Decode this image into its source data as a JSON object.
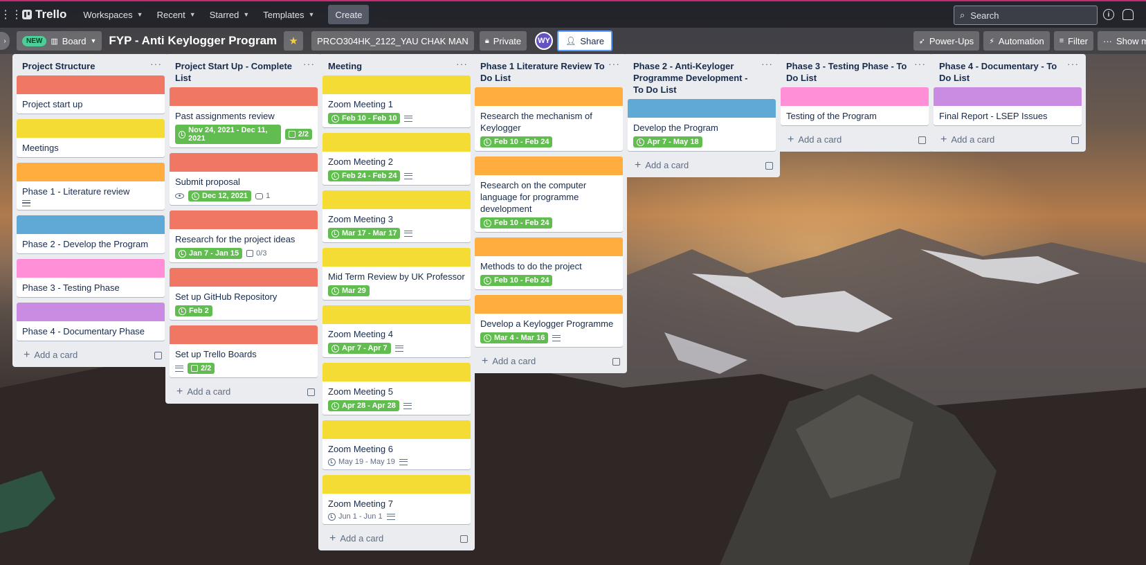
{
  "topbar": {
    "logo": "Trello",
    "nav": [
      "Workspaces",
      "Recent",
      "Starred",
      "Templates"
    ],
    "create_label": "Create",
    "search_label": "Search"
  },
  "board": {
    "new_badge": "NEW",
    "view_label": "Board",
    "title": "FYP - Anti Keylogger Program",
    "workspace": "PRCO304HK_2122_YAU CHAK MAN",
    "visibility": "Private",
    "avatar_initials": "WY",
    "share_label": "Share",
    "power_ups": "Power-Ups",
    "automation": "Automation",
    "filter": "Filter",
    "show_menu": "Show menu"
  },
  "add_card_label": "Add a card",
  "colors": {
    "red": "#f07763",
    "yellow": "#f5dc35",
    "orange": "#ffad3e",
    "blue": "#5fa9d6",
    "pink": "#ff8fd7",
    "purple": "#ca8ce2",
    "green": "#61bd4f"
  },
  "lists": [
    {
      "title": "Project Structure",
      "cards": [
        {
          "title": "Project start up",
          "color": "red"
        },
        {
          "title": "Meetings",
          "color": "yellow"
        },
        {
          "title": "Phase 1 - Literature review",
          "color": "orange",
          "desc": true
        },
        {
          "title": "Phase 2 - Develop the Program",
          "color": "blue"
        },
        {
          "title": "Phase 3 - Testing Phase",
          "color": "pink"
        },
        {
          "title": "Phase 4 - Documentary Phase",
          "color": "purple"
        }
      ]
    },
    {
      "title": "Project Start Up - Complete List",
      "cards": [
        {
          "title": "Past assignments review",
          "color": "red",
          "date": "Nov 24, 2021 - Dec 11, 2021",
          "check": "2/2",
          "check_done": true
        },
        {
          "title": "Submit proposal",
          "color": "red",
          "watch": true,
          "date": "Dec 12, 2021",
          "comments": "1"
        },
        {
          "title": "Research for the project ideas",
          "color": "red",
          "date": "Jan 7 - Jan 15",
          "check": "0/3",
          "check_done": false
        },
        {
          "title": "Set up GitHub Repository",
          "color": "red",
          "date": "Feb 2"
        },
        {
          "title": "Set up Trello Boards",
          "color": "red",
          "desc": true,
          "check": "2/2",
          "check_done": true
        }
      ]
    },
    {
      "title": "Meeting",
      "cards": [
        {
          "title": "Zoom Meeting 1",
          "color": "yellow",
          "date": "Feb 10 - Feb 10",
          "desc": true
        },
        {
          "title": "Zoom Meeting 2",
          "color": "yellow",
          "date": "Feb 24 - Feb 24",
          "desc": true
        },
        {
          "title": "Zoom Meeting 3",
          "color": "yellow",
          "date": "Mar 17 - Mar 17",
          "desc": true
        },
        {
          "title": "Mid Term Review by UK Professor",
          "color": "yellow",
          "date": "Mar 29"
        },
        {
          "title": "Zoom Meeting 4",
          "color": "yellow",
          "date": "Apr 7 - Apr 7",
          "desc": true
        },
        {
          "title": "Zoom Meeting 5",
          "color": "yellow",
          "date": "Apr 28 - Apr 28",
          "desc": true
        },
        {
          "title": "Zoom Meeting 6",
          "color": "yellow",
          "date_plain": "May 19 - May 19",
          "desc": true
        },
        {
          "title": "Zoom Meeting 7",
          "color": "yellow",
          "date_plain": "Jun 1 - Jun 1",
          "desc": true
        }
      ]
    },
    {
      "title": "Phase 1 Literature Review To Do List",
      "cards": [
        {
          "title": "Research the mechanism of Keylogger",
          "color": "orange",
          "date": "Feb 10 - Feb 24"
        },
        {
          "title": "Research on the computer language for programme development",
          "color": "orange",
          "date": "Feb 10 - Feb 24"
        },
        {
          "title": "Methods to do the project",
          "color": "orange",
          "date": "Feb 10 - Feb 24"
        },
        {
          "title": "Develop a Keylogger Programme",
          "color": "orange",
          "date": "Mar 4 - Mar 16",
          "desc": true
        }
      ]
    },
    {
      "title": "Phase 2 - Anti-Keyloger Programme Development - To Do List",
      "cards": [
        {
          "title": "Develop the Program",
          "color": "blue",
          "date": "Apr 7 - May 18"
        }
      ]
    },
    {
      "title": "Phase 3 - Testing Phase - To Do List",
      "cards": [
        {
          "title": "Testing of the Program",
          "color": "pink"
        }
      ]
    },
    {
      "title": "Phase 4 - Documentary - To Do List",
      "cards": [
        {
          "title": "Final Report - LSEP Issues",
          "color": "purple"
        }
      ]
    }
  ]
}
